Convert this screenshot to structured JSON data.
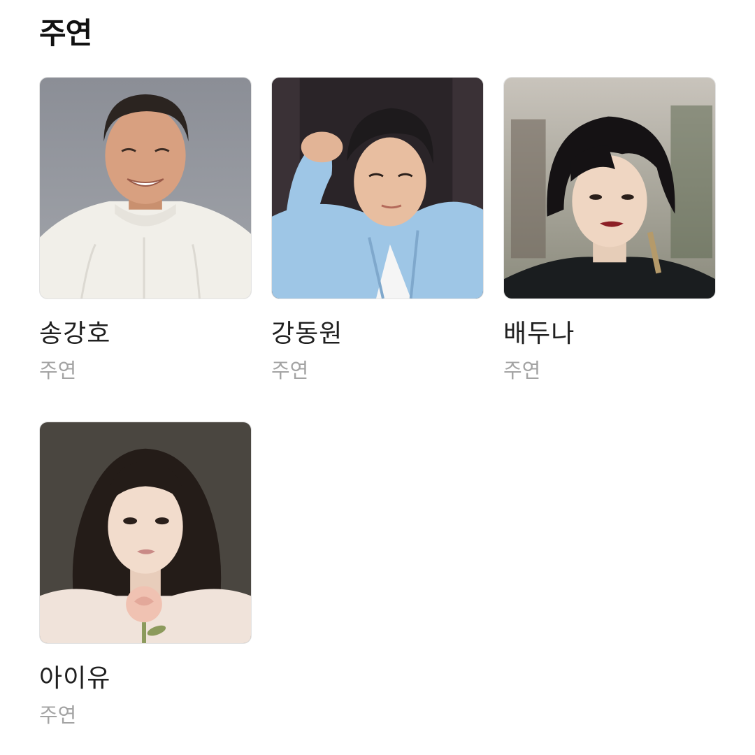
{
  "section": {
    "title": "주연"
  },
  "cast": [
    {
      "name": "송강호",
      "role": "주연",
      "photo_icon": "actor-portrait"
    },
    {
      "name": "강동원",
      "role": "주연",
      "photo_icon": "actor-portrait"
    },
    {
      "name": "배두나",
      "role": "주연",
      "photo_icon": "actor-portrait"
    },
    {
      "name": "아이유",
      "role": "주연",
      "photo_icon": "actor-portrait"
    }
  ]
}
